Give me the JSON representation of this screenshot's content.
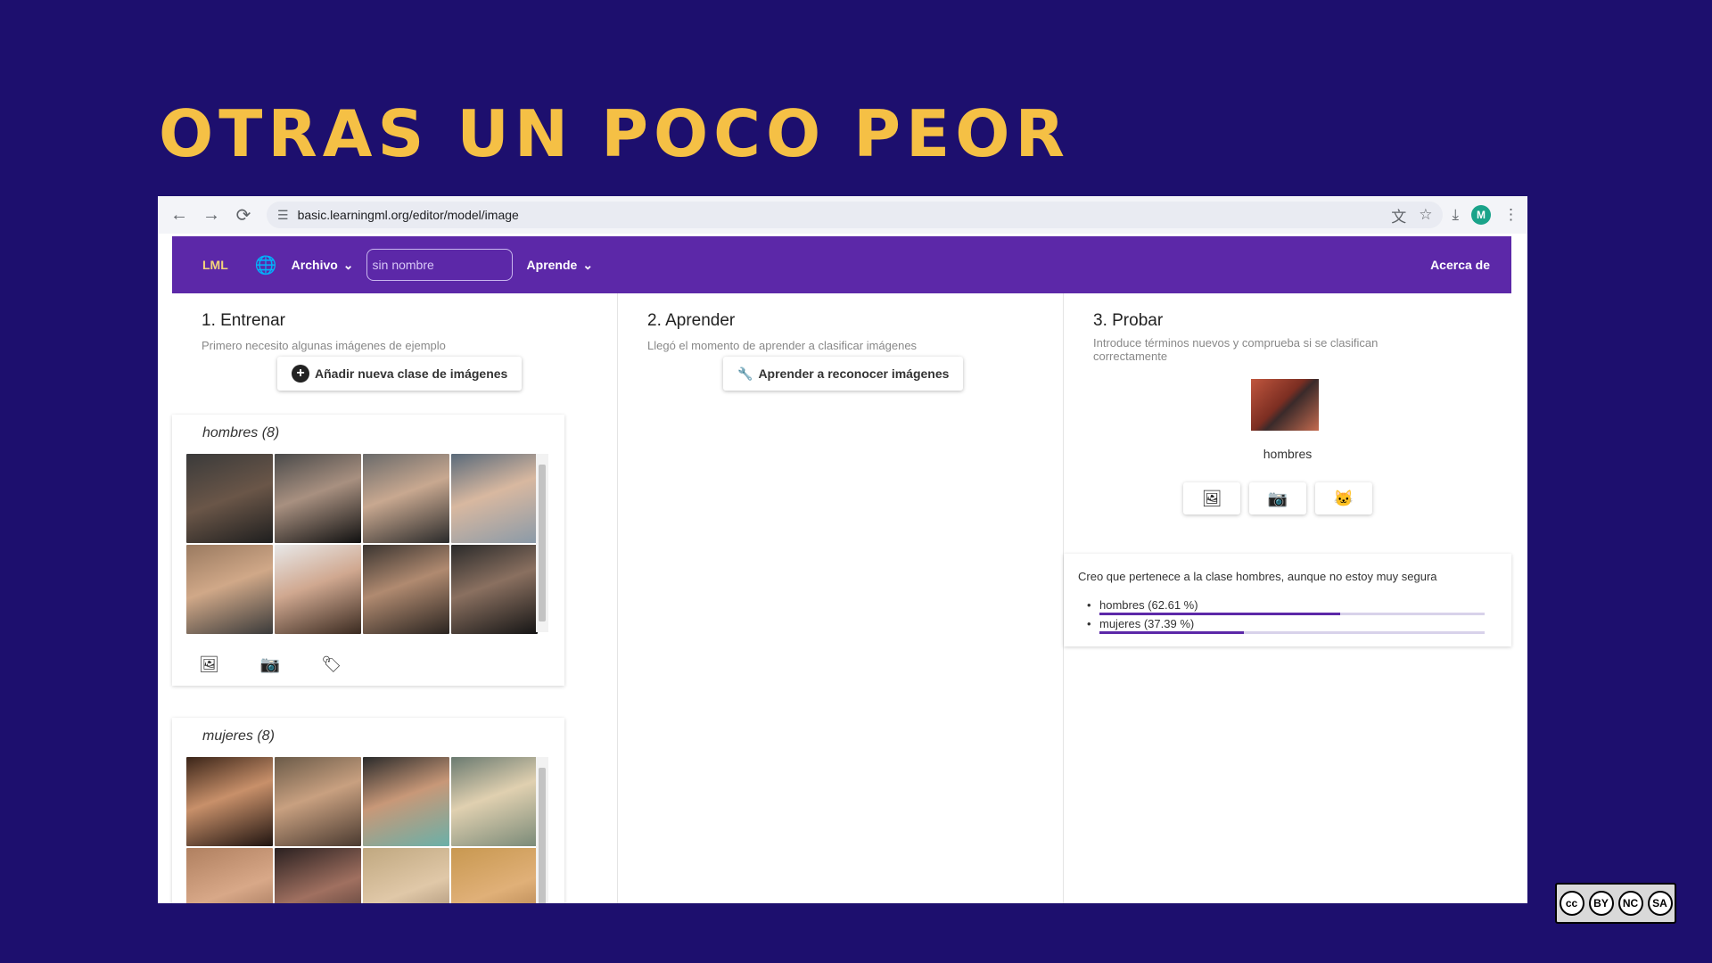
{
  "slide": {
    "title": "OTRAS UN POCO PEOR"
  },
  "browser": {
    "url": "basic.learningml.org/editor/model/image",
    "avatar_letter": "M"
  },
  "app": {
    "logo": "LML",
    "menu": {
      "archivo": "Archivo",
      "aprende": "Aprende",
      "about": "Acerca de"
    },
    "project_placeholder": "sin nombre"
  },
  "train": {
    "title": "1. Entrenar",
    "subtitle": "Primero necesito algunas imágenes de ejemplo",
    "add_class_label": "Añadir nueva clase de imágenes",
    "classes": [
      {
        "name": "hombres (8)"
      },
      {
        "name": "mujeres (8)"
      }
    ]
  },
  "learn": {
    "title": "2. Aprender",
    "subtitle": "Llegó el momento de aprender a clasificar imágenes",
    "button_label": "Aprender a reconocer imágenes"
  },
  "test": {
    "title": "3. Probar",
    "subtitle": "Introduce términos nuevos y comprueba si se clasifican correctamente",
    "preview_label": "hombres",
    "result_text": "Creo que pertenece a la clase hombres, aunque no estoy muy segura",
    "probs": [
      {
        "label": "hombres (62.61 %)",
        "value": 62.61
      },
      {
        "label": "mujeres (37.39 %)",
        "value": 37.39
      }
    ]
  },
  "license": {
    "labels": [
      "BY",
      "NC",
      "SA"
    ]
  },
  "colors": {
    "background": "#1d0f6e",
    "title": "#f5c045",
    "appbar": "#5c28a8"
  }
}
